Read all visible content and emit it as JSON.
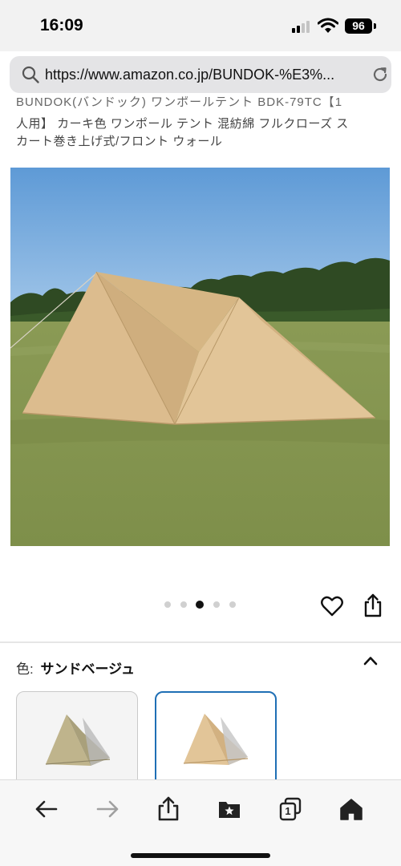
{
  "status": {
    "time": "16:09",
    "battery": "96"
  },
  "browser": {
    "url": "https://www.amazon.co.jp/BUNDOK-%E3%..."
  },
  "product": {
    "title_partial": "BUNDOK(バンドック) ワンポールテント BDK-79TC【1",
    "title_line2": "人用】 カーキ色 ワンポール テント 混紡綿 フルクローズ ス",
    "title_line3": "カート巻き上げ式/フロント ウォール"
  },
  "carousel": {
    "count": 5,
    "active_index": 2
  },
  "variation": {
    "label": "色:",
    "value": "サンドベージュ"
  },
  "icons": {
    "search": "search-icon",
    "reload": "reload-icon",
    "heart": "heart-icon",
    "share": "share-icon",
    "back": "back-arrow-icon",
    "forward": "forward-arrow-icon",
    "bookmarks": "bookmarks-icon",
    "tabs": "tabs-icon",
    "home": "home-icon"
  },
  "toolbar": {
    "tabs_count": "1"
  },
  "colors": {
    "accent": "#1f6fb5",
    "tent": "#dcbc8e"
  }
}
